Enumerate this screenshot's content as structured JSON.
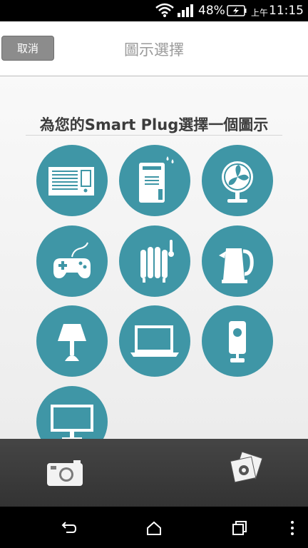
{
  "status_bar": {
    "battery_percent": "48%",
    "ampm": "上午",
    "time": "11:15",
    "icons": [
      "wifi-icon",
      "signal-icon",
      "battery-charging-icon"
    ]
  },
  "header": {
    "cancel_label": "取消",
    "title": "圖示選擇"
  },
  "content": {
    "prompt": "為您的Smart Plug選擇一個圖示",
    "icons": [
      "air-conditioner-icon",
      "humidifier-icon",
      "fan-icon",
      "game-controller-icon",
      "oil-heater-icon",
      "kettle-icon",
      "lamp-icon",
      "laptop-icon",
      "speaker-icon",
      "monitor-icon"
    ]
  },
  "bottom_bar": {
    "icons": [
      "camera-icon",
      "photo-gallery-icon"
    ]
  },
  "nav_bar": {
    "icons": [
      "back-icon",
      "home-icon",
      "recent-apps-icon",
      "menu-icon"
    ]
  },
  "colors": {
    "icon_circle": "#3f96a6",
    "cancel_button": "#8c8c8c",
    "bottom_bar": "#3c3c3c"
  }
}
